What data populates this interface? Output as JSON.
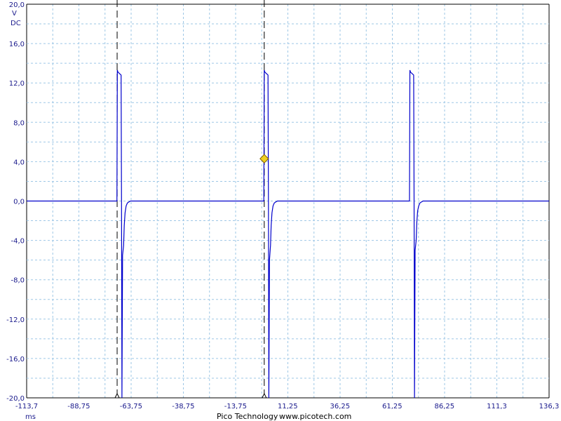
{
  "chart_data": {
    "type": "line",
    "title": "",
    "xlabel": "ms",
    "ylabel": "V",
    "coupling": "DC",
    "xlim": [
      -113.7,
      136.3
    ],
    "ylim": [
      -20,
      20
    ],
    "grid": true,
    "x_tick_labels": [
      "-113,7",
      "-88,75",
      "-63,75",
      "-38,75",
      "-13,75",
      "11,25",
      "36,25",
      "61,25",
      "86,25",
      "111,3",
      "136,3"
    ],
    "x_ticks": [
      -113.7,
      -88.75,
      -63.75,
      -38.75,
      -13.75,
      11.25,
      36.25,
      61.25,
      86.25,
      111.3,
      136.3
    ],
    "y_tick_labels": [
      "20,0",
      "16,0",
      "12,0",
      "8,0",
      "4,0",
      "0,0",
      "-4,0",
      "-8,0",
      "-12,0",
      "-16,0",
      "-20,0"
    ],
    "y_ticks": [
      20,
      16,
      12,
      8,
      4,
      0,
      -4,
      -8,
      -12,
      -16,
      -20
    ],
    "colors": {
      "trace": "#0000cc",
      "grid": "#9ec7e6",
      "marker": "#000000",
      "trigger": "#f0d020",
      "axis_text": "#1a1a8c"
    },
    "series": [
      {
        "values_x": [
          -113.7,
          -70.5,
          -70.2,
          -69.8,
          -69.0,
          -68.4,
          -68.1,
          -67.8,
          -67.3,
          -67.0,
          -66.6,
          -66.0,
          -65.0,
          -64.0,
          -62.0,
          -113.7
        ],
        "pulses": [
          {
            "x": [
              -70.5,
              -70.3,
              -70.0,
              -69.5,
              -69.0,
              -68.5,
              -68.3,
              -68.1,
              -67.8,
              -67.3,
              -67.0,
              -66.6,
              -66.1,
              -65.5,
              -64.8,
              -64.0,
              -62.0
            ],
            "y": [
              0,
              13.3,
              13.1,
              13.0,
              12.9,
              12.8,
              0.0,
              -20.0,
              -5.5,
              -4.5,
              -2.5,
              -1.2,
              -0.5,
              -0.2,
              -0.1,
              0.0,
              0.0
            ]
          },
          {
            "x": [
              -0.2,
              0.0,
              0.3,
              0.8,
              1.3,
              1.8,
              2.0,
              2.2,
              2.5,
              3.0,
              3.3,
              3.7,
              4.2,
              4.8,
              5.5,
              6.3,
              8.3
            ],
            "y": [
              0,
              13.3,
              13.1,
              13.0,
              12.9,
              12.8,
              0.0,
              -20.0,
              -6.0,
              -4.5,
              -2.5,
              -1.2,
              -0.5,
              -0.2,
              -0.1,
              0.0,
              0.0
            ]
          },
          {
            "x": [
              69.5,
              69.7,
              70.0,
              70.5,
              71.0,
              71.5,
              71.7,
              71.9,
              72.2,
              72.7,
              73.0,
              73.4,
              73.9,
              74.5,
              75.2,
              76.0,
              78.0
            ],
            "y": [
              0,
              13.3,
              13.1,
              13.0,
              12.9,
              12.8,
              0.0,
              -20.0,
              -5.0,
              -4.0,
              -2.2,
              -1.0,
              -0.5,
              -0.2,
              -0.1,
              0.0,
              0.0
            ]
          }
        ]
      }
    ],
    "markers": [
      {
        "x": -70.4
      },
      {
        "x": 0.0
      }
    ],
    "trigger": {
      "x": 0.0,
      "y": 4.3
    }
  },
  "footer": {
    "vendor": "Pico Technology",
    "url": "www.picotech.com"
  }
}
